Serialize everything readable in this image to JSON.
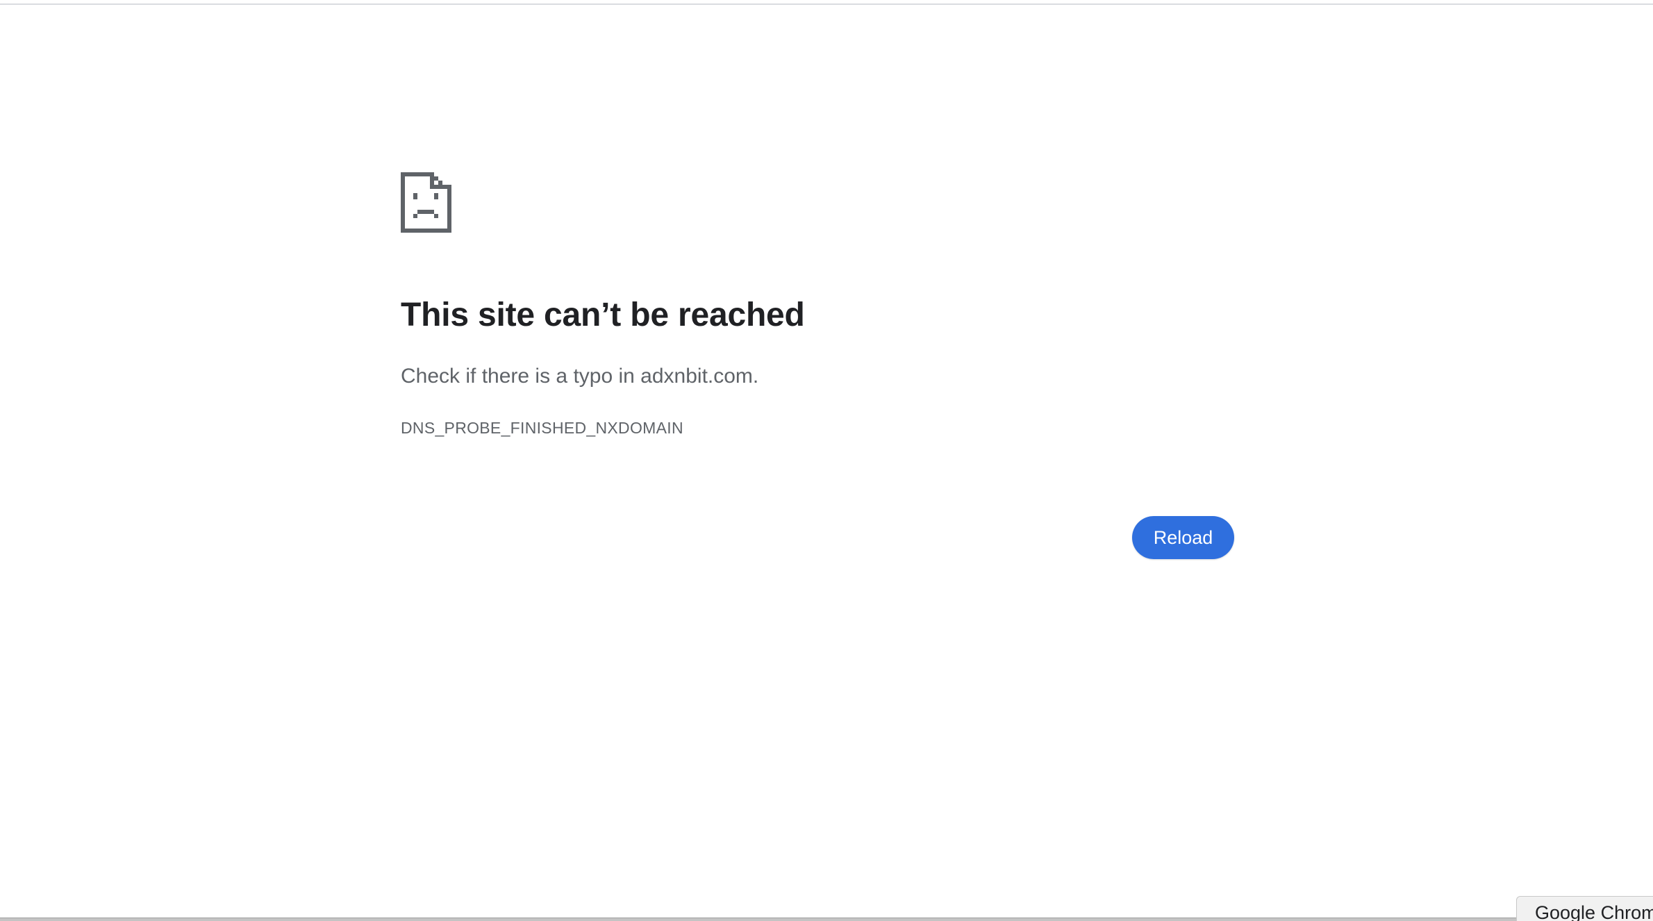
{
  "error_page": {
    "icon": "sad-document-icon",
    "title": "This site can’t be reached",
    "suggestion": "Check if there is a typo in adxnbit.com.",
    "error_code": "DNS_PROBE_FINISHED_NXDOMAIN",
    "reload_label": "Reload"
  },
  "tooltip": {
    "text": "Google Chrome"
  },
  "colors": {
    "accent": "#2f6fde",
    "title_text": "#202124",
    "body_text": "#5f6368",
    "icon": "#5f6368"
  }
}
